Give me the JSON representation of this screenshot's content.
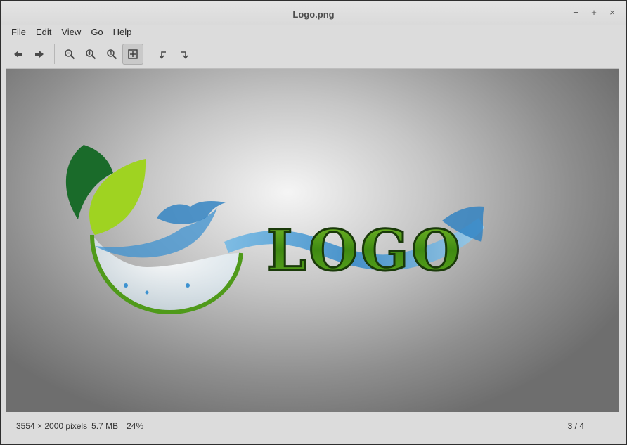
{
  "window": {
    "title": "Logo.png"
  },
  "wm": {
    "minimize": "−",
    "maximize": "+",
    "close": "×"
  },
  "menu": {
    "file": "File",
    "edit": "Edit",
    "view": "View",
    "go": "Go",
    "help": "Help"
  },
  "toolbar": {
    "icons": [
      "back-icon",
      "forward-icon",
      "zoom-out-icon",
      "zoom-in-icon",
      "zoom-original-icon",
      "best-fit-icon",
      "rotate-left-icon",
      "rotate-right-icon"
    ],
    "best_fit_active": true
  },
  "image": {
    "logo_text": "LOGO"
  },
  "status": {
    "dimensions": "3554 × 2000 pixels",
    "size": "5.7 MB",
    "zoom": "24%",
    "position": "3 / 4"
  },
  "colors": {
    "dark_leaf": "#1a6b2a",
    "light_leaf": "#9fd321",
    "water": "#2f86c8"
  }
}
